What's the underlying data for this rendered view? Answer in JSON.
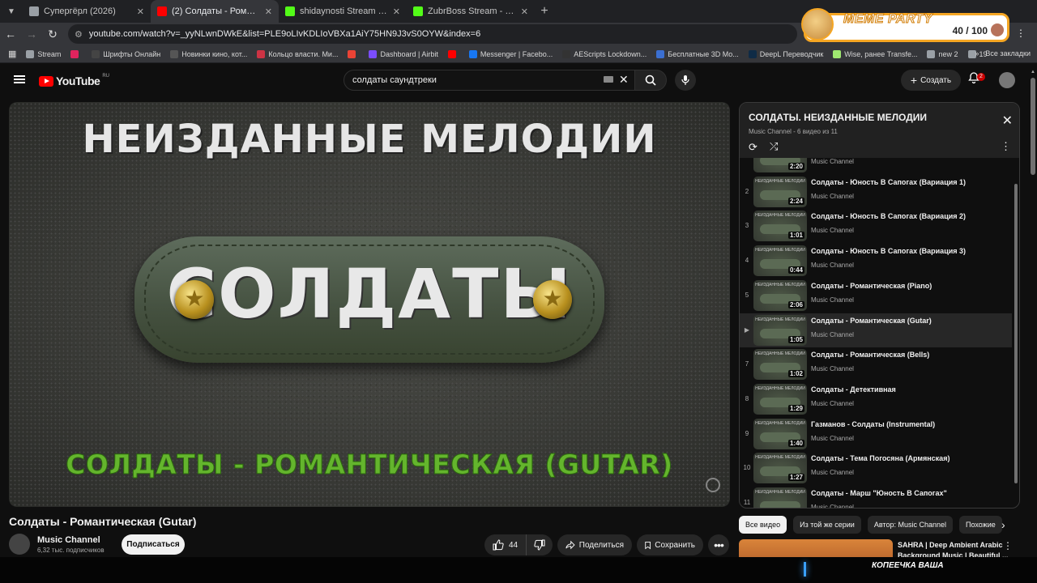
{
  "browser": {
    "tabs": [
      {
        "title": "Супергёрл (2026)",
        "color": "#9aa0a6"
      },
      {
        "title": "(2) Солдаты - Романтическая (Gutar)",
        "color": "#ff0000"
      },
      {
        "title": "shidaynosti Stream - Watch Live",
        "color": "#53fc18"
      },
      {
        "title": "ZubrBoss Stream - Watch Live",
        "color": "#53fc18"
      }
    ],
    "url": "youtube.com/watch?v=_yyNLwnDWkE&list=PLE9oLIvKDLIoVBXa1AiY75HN9J3vS0OYW&index=6",
    "bookmarks": [
      {
        "label": "Stream",
        "color": "#9aa0a6"
      },
      {
        "label": "",
        "color": "#e0245e"
      },
      {
        "label": "Шрифты Онлайн",
        "color": "#444"
      },
      {
        "label": "Новинки кино, кот...",
        "color": "#555"
      },
      {
        "label": "Кольцо власти. Ми...",
        "color": "#cc3344"
      },
      {
        "label": "",
        "color": "#ea4335"
      },
      {
        "label": "Dashboard | Airbit",
        "color": "#7b4dff"
      },
      {
        "label": "",
        "color": "#ff0000"
      },
      {
        "label": "Messenger | Facebo...",
        "color": "#1877f2"
      },
      {
        "label": "AEScripts Lockdown...",
        "color": "#333"
      },
      {
        "label": "Бесплатные 3D Mo...",
        "color": "#3b6fd1"
      },
      {
        "label": "DeepL Переводчик",
        "color": "#0f2b46"
      },
      {
        "label": "Wise, ранее Transfe...",
        "color": "#9fe870"
      },
      {
        "label": "new 2",
        "color": "#9aa0a6"
      },
      {
        "label": "19",
        "color": "#9aa0a6"
      }
    ],
    "bookmarks_more": "»",
    "all_bookmarks": "Все закладки"
  },
  "meme_party": {
    "title": "MEME PARTY",
    "score": "40 / 100"
  },
  "header": {
    "logo_text": "YouTube",
    "logo_region": "RU",
    "search_value": "солдаты саундтреки",
    "create_label": "Создать",
    "notifications": "2"
  },
  "video": {
    "title": "Солдаты - Романтическая (Gutar)",
    "thumb_top_text": "НЕИЗДАННЫЕ МЕЛОДИИ",
    "thumb_center_text": "СОЛДАТЫ",
    "thumb_bottom_text": "СОЛДАТЫ - РОМАНТИЧЕСКАЯ (GUTAR)",
    "channel": "Music Channel",
    "subscribers": "6,32 тыс. подписчиков",
    "subscribe_label": "Подписаться",
    "likes": "44",
    "share_label": "Поделиться",
    "save_label": "Сохранить"
  },
  "playlist": {
    "title": "СОЛДАТЫ. НЕИЗДАННЫЕ МЕЛОДИИ",
    "subtitle": "Music Channel - 6 видео из 11",
    "items": [
      {
        "idx": "",
        "title": "",
        "channel": "Music Channel",
        "duration": "2:20",
        "current": false
      },
      {
        "idx": "2",
        "title": "Солдаты - Юность В Сапогах (Вариация 1)",
        "channel": "Music Channel",
        "duration": "2:24",
        "current": false
      },
      {
        "idx": "3",
        "title": "Солдаты - Юность В Сапогах (Вариация 2)",
        "channel": "Music Channel",
        "duration": "1:01",
        "current": false
      },
      {
        "idx": "4",
        "title": "Солдаты - Юность В Сапогах (Вариация 3)",
        "channel": "Music Channel",
        "duration": "0:44",
        "current": false
      },
      {
        "idx": "5",
        "title": "Солдаты - Романтическая (Piano)",
        "channel": "Music Channel",
        "duration": "2:06",
        "current": false
      },
      {
        "idx": "▶",
        "title": "Солдаты - Романтическая (Gutar)",
        "channel": "Music Channel",
        "duration": "1:05",
        "current": true
      },
      {
        "idx": "7",
        "title": "Солдаты - Романтическая (Bells)",
        "channel": "Music Channel",
        "duration": "1:02",
        "current": false
      },
      {
        "idx": "8",
        "title": "Солдаты - Детективная",
        "channel": "Music Channel",
        "duration": "1:29",
        "current": false
      },
      {
        "idx": "9",
        "title": "Газманов - Солдаты (Instrumental)",
        "channel": "Music Channel",
        "duration": "1:40",
        "current": false
      },
      {
        "idx": "10",
        "title": "Солдаты - Тема Погосяна (Армянская)",
        "channel": "Music Channel",
        "duration": "1:27",
        "current": false
      },
      {
        "idx": "11",
        "title": "Солдаты - Марш \"Юность В Сапогах\"",
        "channel": "Music Channel",
        "duration": "",
        "current": false
      }
    ],
    "thumb_mini_text": "НЕИЗДАННЫЕ МЕЛОДИИ"
  },
  "chips": [
    "Все видео",
    "Из той же серии",
    "Автор: Music Channel",
    "Похожие"
  ],
  "recommendation": {
    "title": "SAHRA | Deep Ambient Arabic Background Music | Beautiful ..."
  },
  "overlay": {
    "text": "КОПЕЕЧКА ВАША"
  }
}
